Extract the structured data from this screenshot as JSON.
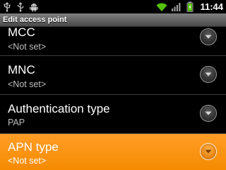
{
  "status_bar": {
    "time": "11:44",
    "left_icons": [
      "usb-icon",
      "usb-debug-icon",
      "android-icon"
    ],
    "right_icons": [
      "wifi-icon",
      "signal-icon",
      "battery-icon"
    ]
  },
  "title": "Edit access point",
  "items": [
    {
      "title": "MCC",
      "summary": "<Not set>",
      "highlighted": false
    },
    {
      "title": "MNC",
      "summary": "<Not set>",
      "highlighted": false
    },
    {
      "title": "Authentication type",
      "summary": "PAP",
      "highlighted": false
    },
    {
      "title": "APN type",
      "summary": "<Not set>",
      "highlighted": true
    }
  ],
  "colors": {
    "highlight": "#f58a00",
    "wifi": "#54c40a",
    "battery": "#54c40a"
  }
}
